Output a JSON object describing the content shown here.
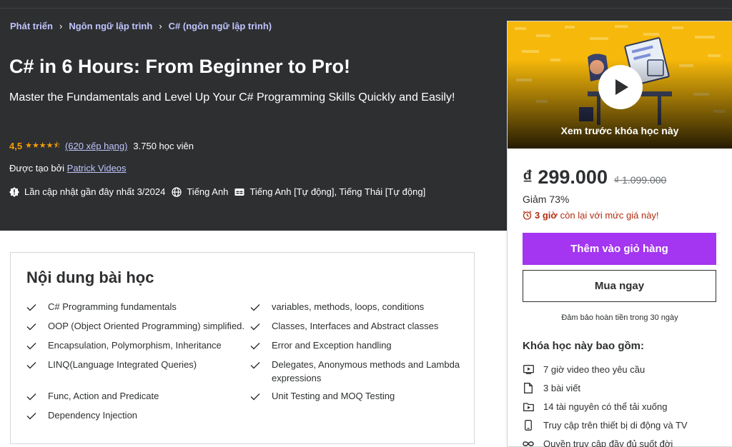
{
  "breadcrumb": [
    {
      "label": "Phát triển"
    },
    {
      "label": "Ngôn ngữ lập trình"
    },
    {
      "label": "C# (ngôn ngữ lập trình)"
    }
  ],
  "course": {
    "title": "C# in 6 Hours: From Beginner to Pro!",
    "subtitle": "Master the Fundamentals and Level Up Your C# Programming Skills Quickly and Easily!",
    "rating": "4,5",
    "rating_stars": 4.5,
    "stars_glyph": "★★★★⯪",
    "rating_count": "(620 xếp hạng)",
    "students": "3.750 học viên",
    "created_by_prefix": "Được tạo bởi ",
    "creator": "Patrick Videos",
    "last_updated": "Lần cập nhật gần đây nhất 3/2024",
    "language": "Tiếng Anh",
    "captions": "Tiếng Anh [Tự động], Tiếng Thái [Tự động]"
  },
  "sidebar": {
    "preview_label": "Xem trước khóa học này",
    "price": "₫ 299.000",
    "old_price": "₫ 1.099.000",
    "discount": "Giảm 73%",
    "timer_hours": "3 giờ",
    "timer_text": "còn lại với mức giá này!",
    "add_to_cart": "Thêm vào giỏ hàng",
    "buy_now": "Mua ngay",
    "guarantee": "Đảm bảo hoàn tiền trong 30 ngày",
    "includes_title": "Khóa học này bao gồm:",
    "includes": [
      {
        "icon": "video-icon",
        "label": "7 giờ video theo yêu cầu"
      },
      {
        "icon": "article-icon",
        "label": "3 bài viết"
      },
      {
        "icon": "download-icon",
        "label": "14 tài nguyên có thể tải xuống"
      },
      {
        "icon": "mobile-icon",
        "label": "Truy cập trên thiết bị di động và TV"
      },
      {
        "icon": "infinity-icon",
        "label": "Quyền truy cập đầy đủ suốt đời"
      }
    ]
  },
  "learn": {
    "title": "Nội dung bài học",
    "items": [
      "C# Programming fundamentals",
      "variables, methods, loops, conditions",
      "OOP (Object Oriented Programming) simplified.",
      "Classes, Interfaces and Abstract classes",
      "Encapsulation, Polymorphism, Inheritance",
      "Error and Exception handling",
      "LINQ(Language Integrated Queries)",
      "Delegates, Anonymous methods and Lambda expressions",
      "Func, Action and Predicate",
      "Unit Testing and MOQ Testing",
      "Dependency Injection"
    ]
  },
  "colors": {
    "hero_bg": "#2d2f31",
    "accent": "#a435f0",
    "link": "#c0c4fc",
    "star": "#f69c08",
    "timer": "#b32d0f"
  }
}
